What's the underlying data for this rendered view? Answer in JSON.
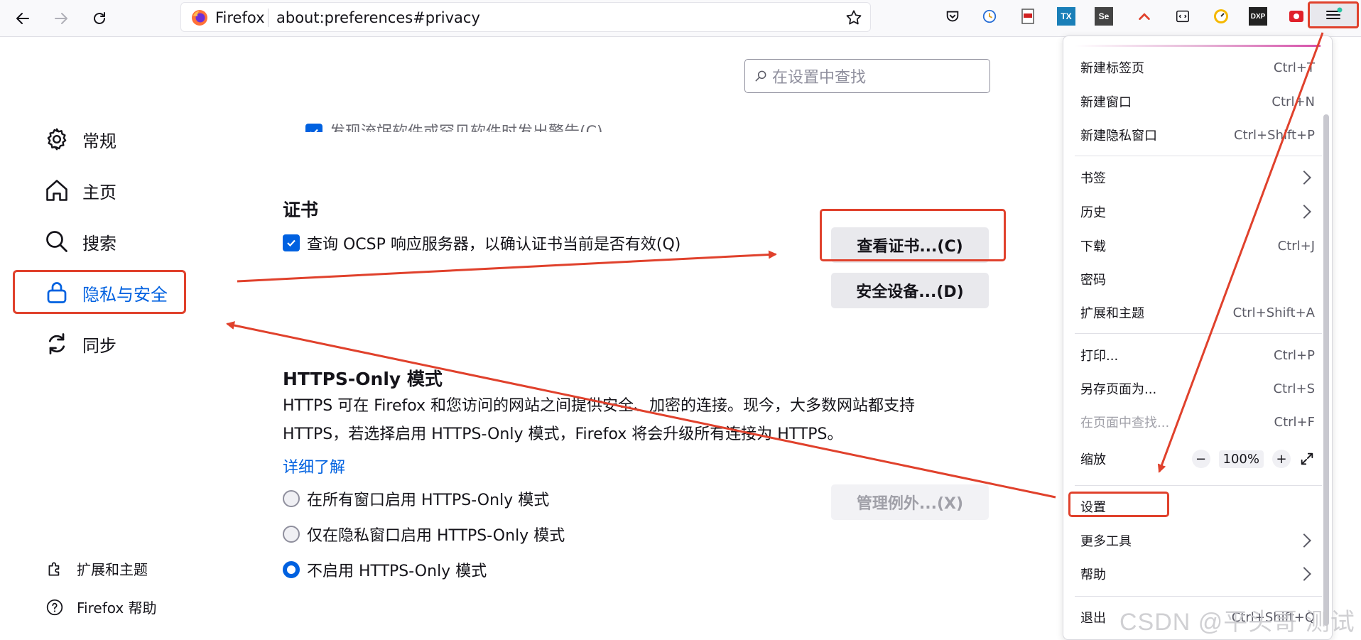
{
  "browser": {
    "brand": "Firefox",
    "url": "about:preferences#privacy",
    "extensions": [
      "pocket-icon",
      "clock-extension-icon",
      "pdf-extension-icon",
      "TX",
      "Se",
      "up-chevron-extension-icon",
      "devtools-extension-icon",
      "speed-extension-icon",
      "DXP",
      "red-extension-icon"
    ]
  },
  "sidebar": {
    "items": [
      {
        "label": "常规",
        "icon": "gear-icon"
      },
      {
        "label": "主页",
        "icon": "home-icon"
      },
      {
        "label": "搜索",
        "icon": "search-icon"
      },
      {
        "label": "隐私与安全",
        "icon": "lock-icon"
      },
      {
        "label": "同步",
        "icon": "sync-icon"
      }
    ],
    "bottom": [
      {
        "label": "扩展和主题",
        "icon": "puzzle-icon"
      },
      {
        "label": "Firefox 帮助",
        "icon": "help-icon"
      }
    ]
  },
  "search": {
    "placeholder": "在设置中查找"
  },
  "content": {
    "clipped_text": "发现流氓软件或罕见软件时发出警告(C)",
    "cert": {
      "heading": "证书",
      "ocsp_label": "查询 OCSP 响应服务器，以确认证书当前是否有效(Q)",
      "view_btn": "查看证书...(C)",
      "devices_btn": "安全设备...(D)"
    },
    "https": {
      "heading": "HTTPS-Only 模式",
      "desc_line1": "HTTPS 可在 Firefox 和您访问的网站之间提供安全、加密的连接。现今，大多数网站都支持",
      "desc_line2": "HTTPS，若选择启用 HTTPS-Only 模式，Firefox 将会升级所有连接为 HTTPS。",
      "learn_more": "详细了解",
      "manage_btn": "管理例外...(X)",
      "options": [
        {
          "label": "在所有窗口启用 HTTPS-Only 模式",
          "selected": false
        },
        {
          "label": "仅在隐私窗口启用 HTTPS-Only 模式",
          "selected": false
        },
        {
          "label": "不启用 HTTPS-Only 模式",
          "selected": true
        }
      ]
    }
  },
  "menu": {
    "items": [
      {
        "label": "新建标签页",
        "shortcut": "Ctrl+T"
      },
      {
        "label": "新建窗口",
        "shortcut": "Ctrl+N"
      },
      {
        "label": "新建隐私窗口",
        "shortcut": "Ctrl+Shift+P"
      },
      {
        "label": "书签",
        "shortcut": ""
      },
      {
        "label": "历史",
        "shortcut": ""
      },
      {
        "label": "下载",
        "shortcut": "Ctrl+J"
      },
      {
        "label": "密码",
        "shortcut": ""
      },
      {
        "label": "扩展和主题",
        "shortcut": "Ctrl+Shift+A"
      },
      {
        "label": "打印...",
        "shortcut": "Ctrl+P"
      },
      {
        "label": "另存页面为...",
        "shortcut": "Ctrl+S"
      },
      {
        "label": "在页面中查找...",
        "shortcut": "Ctrl+F"
      },
      {
        "label": "缩放",
        "shortcut": ""
      },
      {
        "label": "设置",
        "shortcut": ""
      },
      {
        "label": "更多工具",
        "shortcut": ""
      },
      {
        "label": "帮助",
        "shortcut": ""
      },
      {
        "label": "退出",
        "shortcut": "Ctrl+Shift+Q"
      }
    ],
    "zoom": {
      "minus": "−",
      "value": "100%",
      "plus": "+"
    }
  },
  "watermark": "CSDN @平头哥 测试",
  "colors": {
    "accent": "#0061e0",
    "annotation_red": "#e0412c"
  }
}
